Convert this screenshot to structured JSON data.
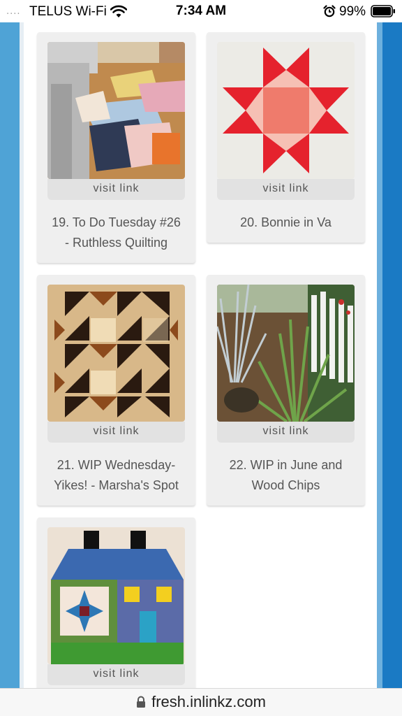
{
  "status_bar": {
    "signal": "....",
    "carrier": "TELUS Wi-Fi",
    "time": "7:34 AM",
    "battery": "99%"
  },
  "url_bar": {
    "url": "fresh.inlinkz.com"
  },
  "cards": [
    {
      "visit_label": "visit link",
      "caption_line1": "19. To Do Tuesday #26",
      "caption_line2": "- Ruthless Quilting"
    },
    {
      "visit_label": "visit link",
      "caption_line1": "20. Bonnie in Va",
      "caption_line2": ""
    },
    {
      "visit_label": "visit link",
      "caption_line1": "21. WIP Wednesday-",
      "caption_line2": "Yikes! - Marsha's Spot"
    },
    {
      "visit_label": "visit link",
      "caption_line1": "22. WIP in June and",
      "caption_line2": "Wood Chips"
    },
    {
      "visit_label": "visit link",
      "caption_line1": "",
      "caption_line2": ""
    }
  ],
  "colors": {
    "rail_left": "#4fa3d6",
    "rail_right": "#1a7ac4",
    "card_bg": "#efefef",
    "visit_bg": "#e2e2e2",
    "text": "#555555"
  }
}
